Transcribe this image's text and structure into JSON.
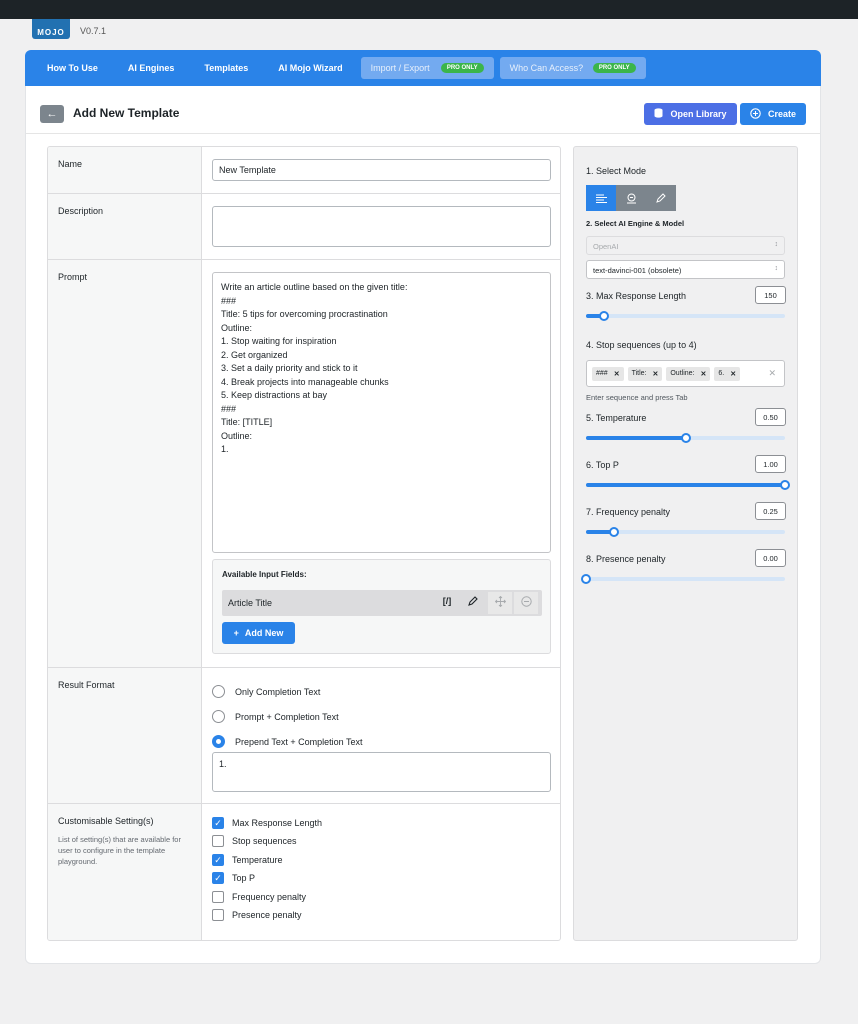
{
  "app": {
    "version": "V0.7.1",
    "logo_text": "MOJO"
  },
  "nav": [
    {
      "label": "How To Use"
    },
    {
      "label": "AI Engines"
    },
    {
      "label": "Templates"
    },
    {
      "label": "AI Mojo Wizard"
    },
    {
      "label": "Import / Export",
      "badge": "PRO ONLY"
    },
    {
      "label": "Who Can Access?",
      "badge": "PRO ONLY"
    }
  ],
  "header": {
    "back_icon": "←",
    "title": "Add New Template",
    "open_library": "Open Library",
    "create": "Create"
  },
  "form": {
    "name_label": "Name",
    "name_value": "New Template",
    "description_label": "Description",
    "description_value": "",
    "prompt_label": "Prompt",
    "prompt_text": "Write an article outline based on the given title:\n###\nTitle: 5 tips for overcoming procrastination\nOutline:\n1. Stop waiting for inspiration\n2. Get organized\n3. Set a daily priority and stick to it\n4. Break projects into manageable chunks\n5. Keep distractions at bay\n###\nTitle: [TITLE]\nOutline:\n1.",
    "available_fields_title": "Available Input Fields:",
    "field_name": "Article Title",
    "field_code_icon": "[/]",
    "add_new": "Add New",
    "result_format_label": "Result Format",
    "result_options": [
      "Only Completion Text",
      "Prompt + Completion Text",
      "Prepend Text + Completion Text"
    ],
    "result_selected": 2,
    "prepend_text": "1.",
    "customisable_label": "Customisable Setting(s)",
    "customisable_desc": "List of setting(s) that are available for user to configure in the template playground.",
    "settings": [
      {
        "label": "Max Response Length",
        "checked": true
      },
      {
        "label": "Stop sequences",
        "checked": false
      },
      {
        "label": "Temperature",
        "checked": true
      },
      {
        "label": "Top P",
        "checked": true
      },
      {
        "label": "Frequency penalty",
        "checked": false
      },
      {
        "label": "Presence penalty",
        "checked": false
      }
    ]
  },
  "side": {
    "mode_label": "1. Select Mode",
    "engine_label": "2. Select AI Engine & Model",
    "engine_value": "OpenAI",
    "model_value": "text-davinci-001 (obsolete)",
    "max_len_label": "3. Max Response Length",
    "max_len_value": "150",
    "max_len_fraction": 0.09,
    "stop_label": "4. Stop sequences (up to 4)",
    "stop_chips": [
      "###",
      "Title:",
      "Outline:",
      "6."
    ],
    "stop_hint": "Enter sequence and press Tab",
    "temp_label": "5. Temperature",
    "temp_value": "0.50",
    "temp_fraction": 0.5,
    "topp_label": "6. Top P",
    "topp_value": "1.00",
    "topp_fraction": 1.0,
    "freq_label": "7. Frequency penalty",
    "freq_value": "0.25",
    "freq_fraction": 0.14,
    "pres_label": "8. Presence penalty",
    "pres_value": "0.00",
    "pres_fraction": 0.0
  },
  "colors": {
    "accent": "#2a83e8",
    "pro_badge": "#3bb54a",
    "topbar": "#1d2327"
  }
}
